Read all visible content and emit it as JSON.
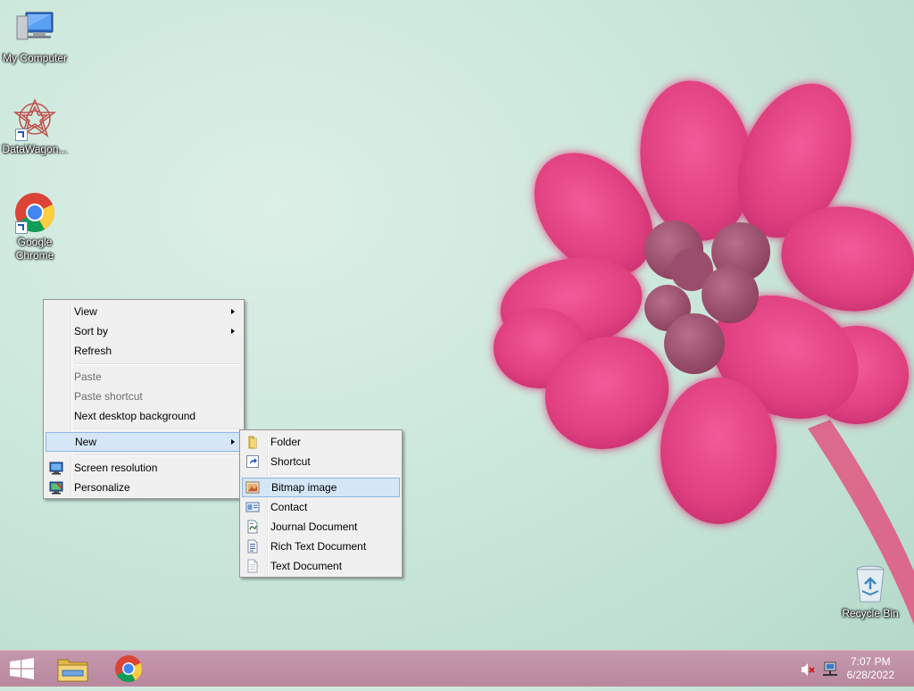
{
  "desktop": {
    "icons": [
      {
        "label": "My Computer",
        "icon": "computer-icon"
      },
      {
        "label": "DataWagon...",
        "icon": "datawagon-icon"
      },
      {
        "label": "Google Chrome",
        "icon": "chrome-icon"
      },
      {
        "label": "Recycle Bin",
        "icon": "recycle-bin-icon"
      }
    ]
  },
  "context_menu": {
    "items": [
      {
        "label": "View",
        "submenu": true,
        "enabled": true
      },
      {
        "label": "Sort by",
        "submenu": true,
        "enabled": true
      },
      {
        "label": "Refresh",
        "enabled": true
      },
      {
        "label": "Paste",
        "enabled": false
      },
      {
        "label": "Paste shortcut",
        "enabled": false
      },
      {
        "label": "Next desktop background",
        "enabled": true
      },
      {
        "label": "New",
        "submenu": true,
        "enabled": true,
        "highlighted": true
      },
      {
        "label": "Screen resolution",
        "icon": "screen-resolution-icon",
        "enabled": true
      },
      {
        "label": "Personalize",
        "icon": "personalize-icon",
        "enabled": true
      }
    ]
  },
  "new_submenu": {
    "items": [
      {
        "label": "Folder",
        "icon": "folder-icon"
      },
      {
        "label": "Shortcut",
        "icon": "shortcut-icon"
      },
      {
        "label": "Bitmap image",
        "icon": "bitmap-icon",
        "highlighted": true
      },
      {
        "label": "Contact",
        "icon": "contact-icon"
      },
      {
        "label": "Journal Document",
        "icon": "journal-icon"
      },
      {
        "label": "Rich Text Document",
        "icon": "rich-text-icon"
      },
      {
        "label": "Text Document",
        "icon": "text-document-icon"
      }
    ]
  },
  "taskbar": {
    "buttons": [
      {
        "name": "start-button",
        "icon": "windows-logo-icon"
      },
      {
        "name": "file-explorer-button",
        "icon": "file-explorer-icon"
      },
      {
        "name": "chrome-taskbar-button",
        "icon": "chrome-icon"
      }
    ],
    "tray": {
      "time": "7:07 PM",
      "date": "6/28/2022",
      "icons": [
        "volume-muted-icon",
        "network-icon"
      ]
    }
  },
  "colors": {
    "taskbar": "#b8879e",
    "menu_highlight": "#d5e6f7",
    "menu_highlight_border": "#90b6e3",
    "flower": "#e0417f"
  }
}
